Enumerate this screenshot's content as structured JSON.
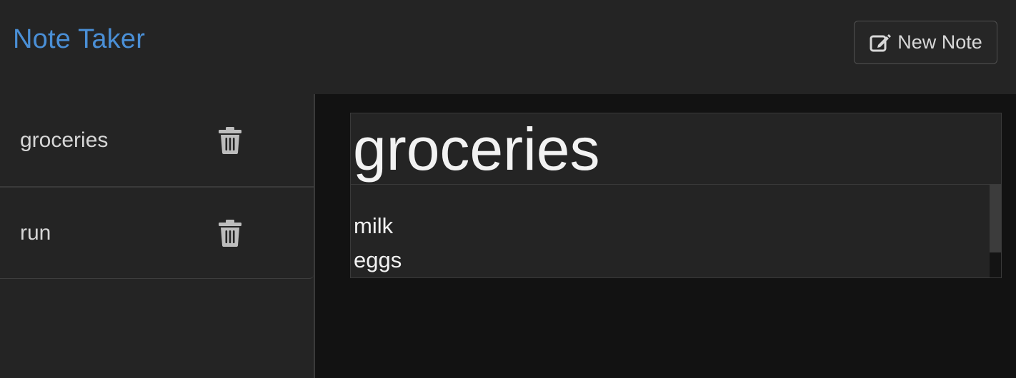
{
  "header": {
    "app_title": "Note Taker",
    "new_note_label": "New Note",
    "new_note_icon": "pencil-square-icon"
  },
  "sidebar": {
    "notes": [
      {
        "label": "groceries",
        "delete_icon": "trash-icon"
      },
      {
        "label": "run",
        "delete_icon": "trash-icon"
      }
    ]
  },
  "editor": {
    "title_value": "groceries",
    "body_value": "milk\neggs"
  },
  "colors": {
    "accent": "#4a8fd6",
    "background": "#242424",
    "main_background": "#121212",
    "text": "#f2f2f2"
  }
}
